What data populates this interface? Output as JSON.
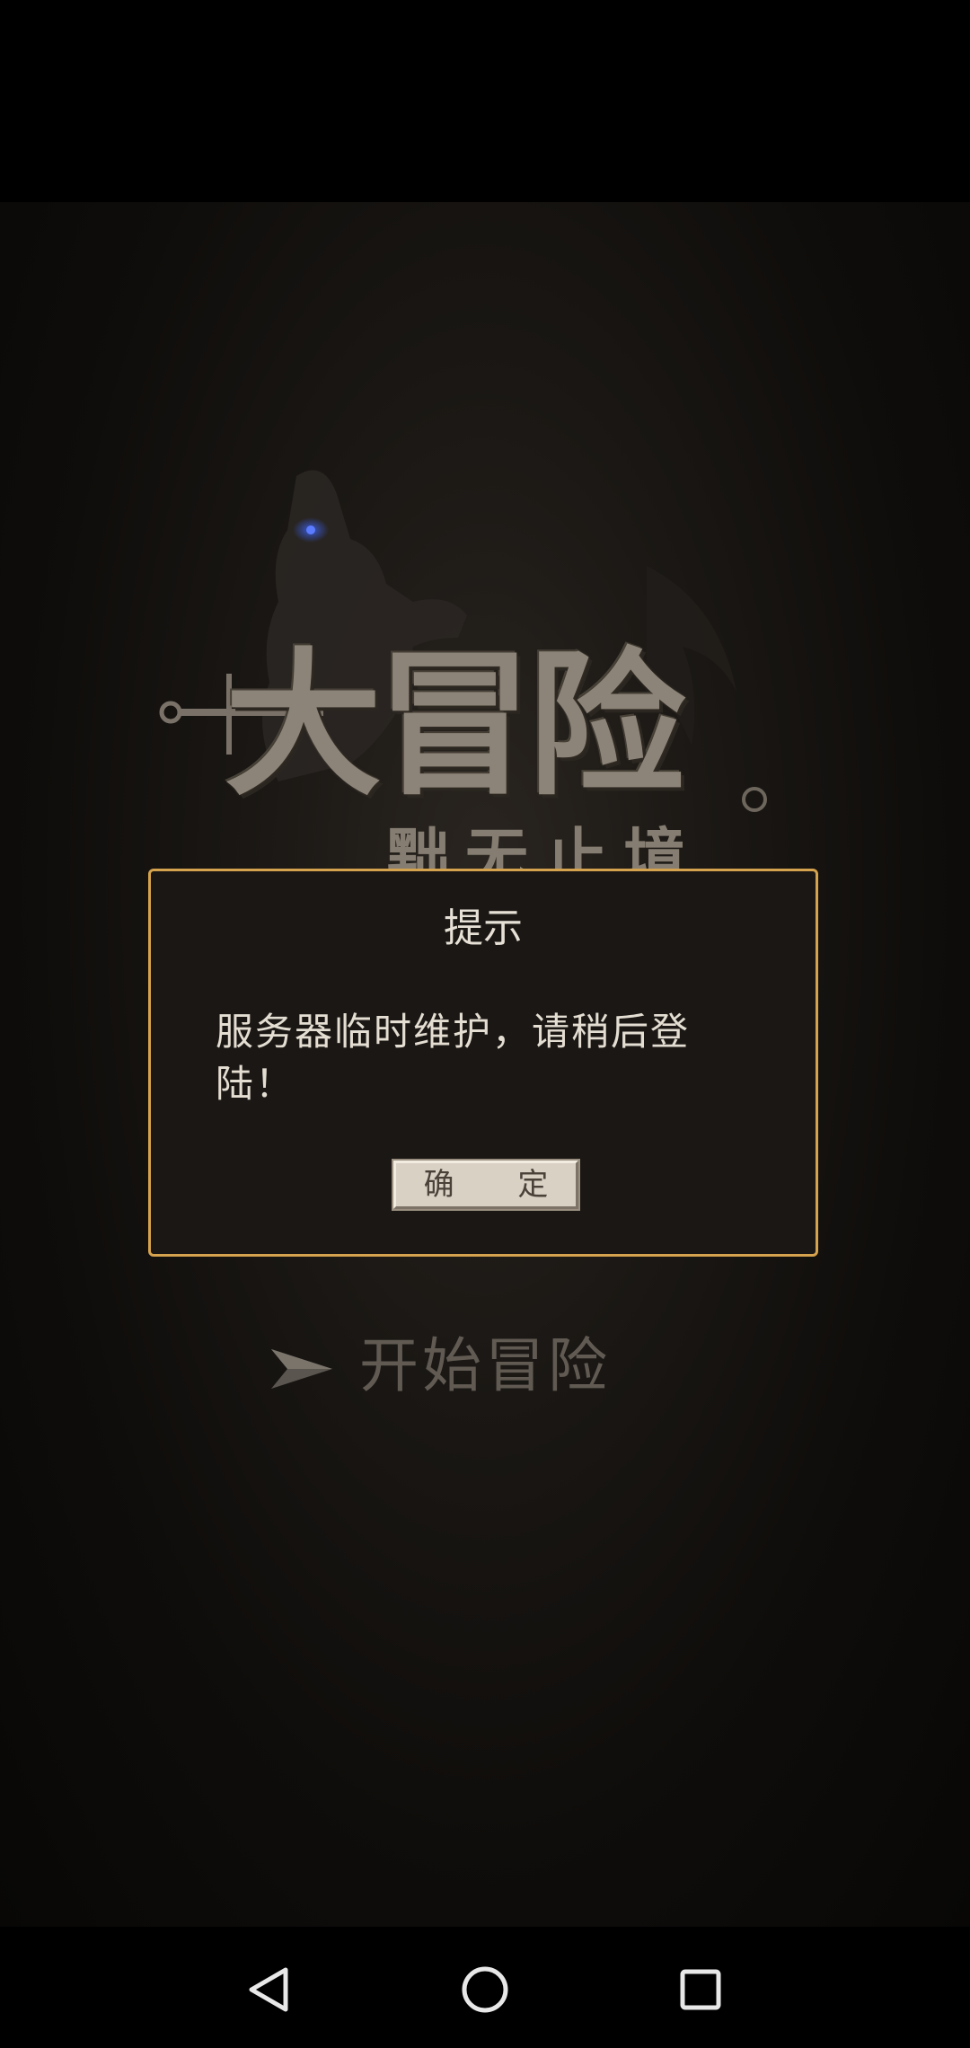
{
  "game": {
    "logo_title": "大冒险",
    "logo_subtitle": "黜无止境",
    "start_label": "开始冒险"
  },
  "dialog": {
    "title": "提示",
    "message": "服务器临时维护，请稍后登陆！",
    "confirm_label": "确 定"
  },
  "navigation": {
    "back": "back-icon",
    "home": "home-icon",
    "recents": "recents-icon"
  },
  "colors": {
    "dialog_border": "#d5a24e",
    "dialog_background": "#1b1714",
    "button_face": "#d9d1c4",
    "background": "#000000"
  }
}
